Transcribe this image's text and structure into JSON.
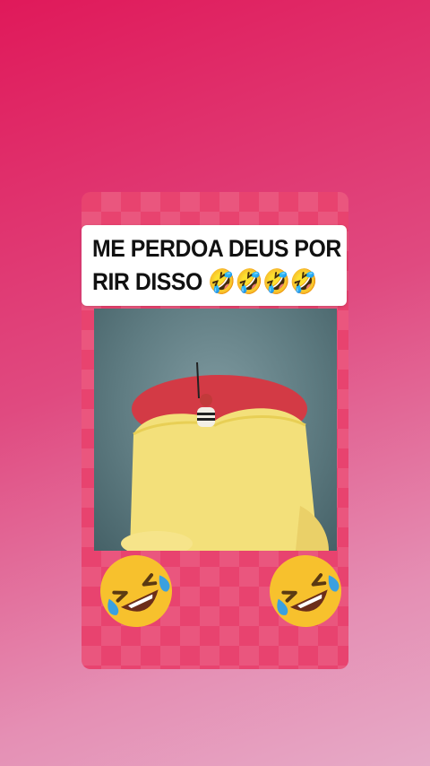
{
  "caption": {
    "line1": "ME PERDOA DEUS POR",
    "line2": "RIR DISSO 🤣🤣🤣🤣"
  },
  "decorations": {
    "emoji_left": "rolling-on-floor-laughing-icon",
    "emoji_right": "rolling-on-floor-laughing-icon"
  },
  "colors": {
    "background_top": "#e0195a",
    "background_bottom": "#e6aac7",
    "card": "#e8436f",
    "caption_bg": "#ffffff"
  }
}
